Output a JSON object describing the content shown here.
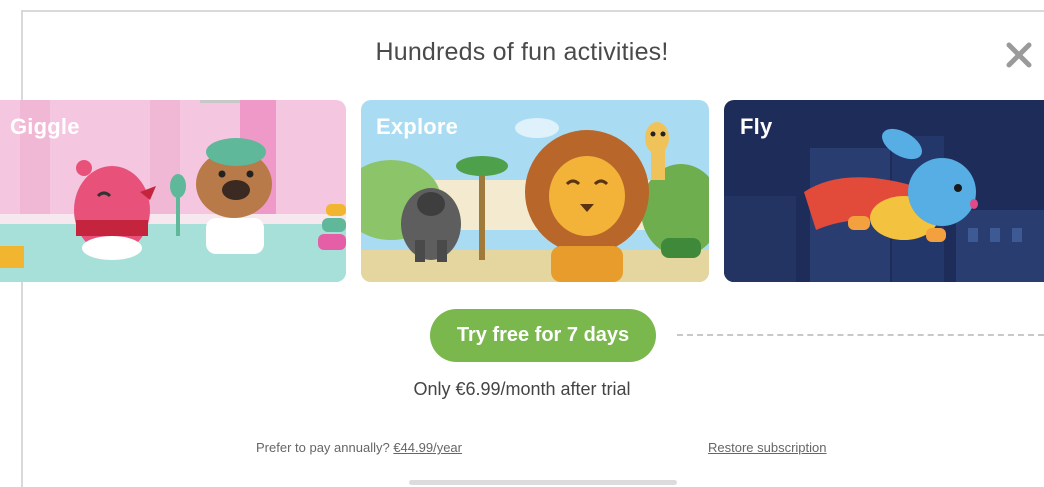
{
  "header": {
    "title": "Hundreds of fun activities!",
    "close_icon": "close-icon"
  },
  "cards": [
    {
      "label": "Giggle",
      "visible_label": "Giggle",
      "image": "bird-and-puppy-illustration",
      "color": "#f4c4de"
    },
    {
      "label": "Explore",
      "image": "lion-gorilla-giraffe-illustration",
      "color": "#a9dcf2"
    },
    {
      "label": "Fly",
      "image": "flying-bunny-hero-illustration",
      "color": "#1e2c5a"
    }
  ],
  "cta": {
    "label": "Try free for 7 days",
    "color": "#7ab84e"
  },
  "pricing": {
    "note": "Only €6.99/month after trial",
    "annual_prompt": "Prefer to pay annually?",
    "annual_link": "€44.99/year"
  },
  "footer": {
    "restore_label": "Restore subscription"
  }
}
